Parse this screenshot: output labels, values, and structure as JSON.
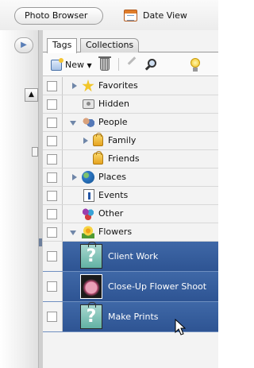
{
  "topbar": {
    "photo_browser_label": "Photo Browser",
    "date_view_label": "Date View"
  },
  "panel": {
    "tabs": [
      {
        "label": "Tags",
        "active": true
      },
      {
        "label": "Collections",
        "active": false
      }
    ],
    "toolbar": {
      "new_label": "New",
      "new_dropdown_icon": "caret-down-icon",
      "icons": [
        "new-tag-icon",
        "trash-icon",
        "pencil-icon",
        "find-icon",
        "lightbulb-icon"
      ]
    },
    "tags": [
      {
        "label": "Favorites",
        "icon": "star-icon",
        "expander": "collapsed"
      },
      {
        "label": "Hidden",
        "icon": "hidden-icon"
      },
      {
        "label": "People",
        "icon": "people-icon",
        "expander": "expanded"
      },
      {
        "label": "Family",
        "icon": "tag-icon",
        "expander": "collapsed"
      },
      {
        "label": "Friends",
        "icon": "tag-icon"
      },
      {
        "label": "Places",
        "icon": "globe-icon",
        "expander": "collapsed"
      },
      {
        "label": "Events",
        "icon": "events-icon"
      },
      {
        "label": "Other",
        "icon": "other-icon"
      },
      {
        "label": "Flowers",
        "icon": "flower-icon",
        "expander": "expanded"
      }
    ],
    "selected_tags": [
      {
        "label": "Client Work",
        "thumb": "question-tag-icon"
      },
      {
        "label": "Close-Up Flower Shoot",
        "thumb": "flower-photo"
      },
      {
        "label": "Make Prints",
        "thumb": "question-tag-icon"
      }
    ]
  },
  "colors": {
    "selection": "#2e5493",
    "expander": "#6f86a8"
  }
}
